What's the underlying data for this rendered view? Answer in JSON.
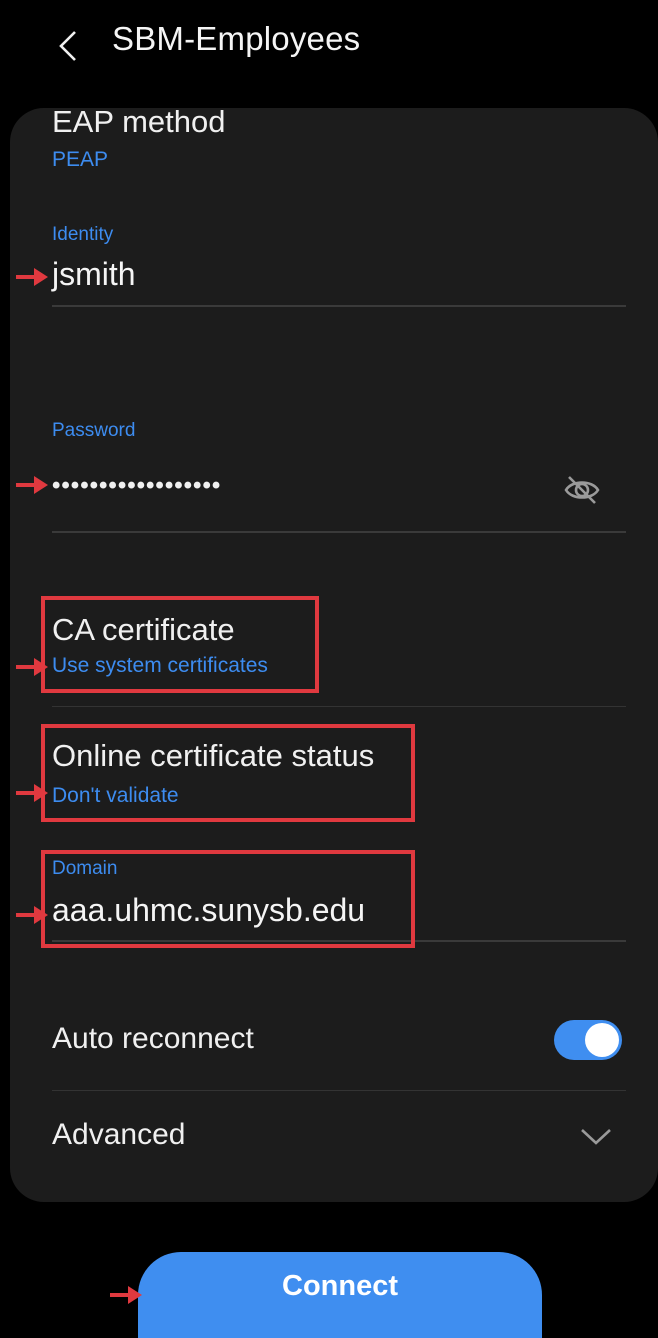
{
  "header": {
    "back_icon": "chevron-left-icon",
    "title": "SBM-Employees"
  },
  "eap": {
    "label": "EAP method",
    "value": "PEAP"
  },
  "identity": {
    "label": "Identity",
    "value": "jsmith"
  },
  "password": {
    "label": "Password",
    "masked": "••••••••••••••••••",
    "toggle_icon": "eye-off-icon"
  },
  "ca_certificate": {
    "label": "CA certificate",
    "value": "Use system certificates"
  },
  "online_status": {
    "label": "Online certificate status",
    "value": "Don't validate"
  },
  "domain": {
    "label": "Domain",
    "value": "aaa.uhmc.sunysb.edu"
  },
  "auto_reconnect": {
    "label": "Auto reconnect",
    "enabled": true
  },
  "advanced": {
    "label": "Advanced",
    "icon": "chevron-down-icon"
  },
  "connect": {
    "label": "Connect"
  },
  "colors": {
    "accent": "#3d8cf0",
    "annotation": "#e0393f",
    "card": "#1c1c1c",
    "background": "#000000"
  }
}
